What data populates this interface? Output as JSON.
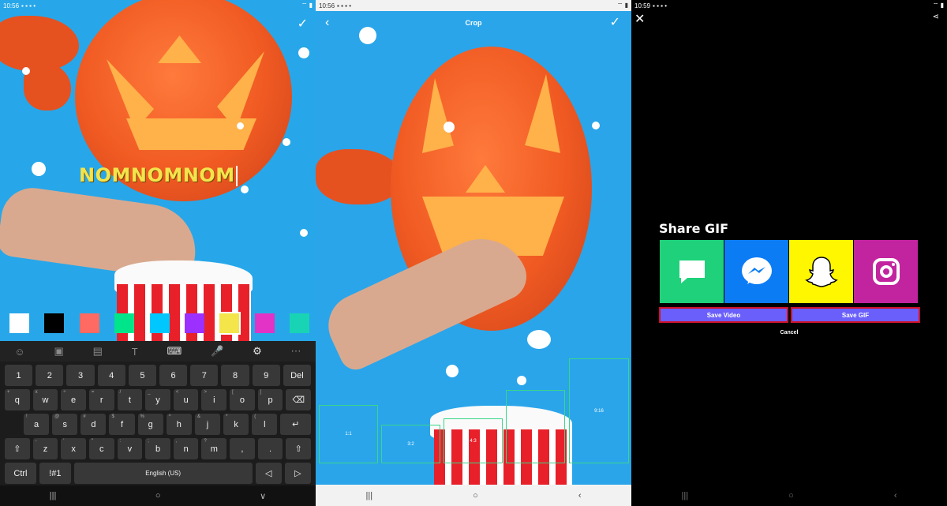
{
  "panel1": {
    "status_time": "10:56",
    "status_icons": "▪ ▪ ▪ •",
    "status_right": "⌔ ▮",
    "text_overlay": "NOMNOMNOM",
    "confirm_glyph": "✓",
    "swatches": [
      "#ffffff",
      "#000000",
      "#ff6a62",
      "#00e58a",
      "#00c8ff",
      "#9b30ff",
      "#f3e54a",
      "#e233c6",
      "#19d4b4"
    ],
    "selected_swatch": 6,
    "keyboard": {
      "toolbar": [
        "☺",
        "▣",
        "▤",
        "T",
        "⌨",
        "🎤",
        "⚙",
        "⋯"
      ],
      "row_numbers": [
        "1",
        "2",
        "3",
        "4",
        "5",
        "6",
        "7",
        "8",
        "9",
        "Del"
      ],
      "row_q": [
        [
          "q",
          "+"
        ],
        [
          "w",
          "x"
        ],
        [
          "e",
          "÷"
        ],
        [
          "r",
          "="
        ],
        [
          "t",
          "/"
        ],
        [
          "y",
          "_"
        ],
        [
          "u",
          "<"
        ],
        [
          "i",
          ">"
        ],
        [
          "o",
          "["
        ],
        [
          "p",
          "]"
        ],
        [
          "⌫",
          ""
        ]
      ],
      "row_a": [
        [
          "a",
          "!"
        ],
        [
          "s",
          "@"
        ],
        [
          "d",
          "#"
        ],
        [
          "f",
          "$"
        ],
        [
          "g",
          "%"
        ],
        [
          "h",
          "^"
        ],
        [
          "j",
          "&"
        ],
        [
          "k",
          "*"
        ],
        [
          "l",
          "("
        ],
        [
          "↵",
          ""
        ]
      ],
      "row_z": [
        [
          "⇧",
          ""
        ],
        [
          "z",
          "-"
        ],
        [
          "x",
          "'"
        ],
        [
          "c",
          "\""
        ],
        [
          "v",
          ":"
        ],
        [
          "b",
          ";"
        ],
        [
          "n",
          ","
        ],
        [
          "m",
          "?"
        ],
        [
          ",",
          ""
        ],
        [
          ".",
          ""
        ],
        [
          "⇧",
          ""
        ]
      ],
      "row_bottom": [
        "Ctrl",
        "!#1",
        "English (US)",
        "◁",
        "▷"
      ]
    },
    "nav": [
      "|||",
      "○",
      "∨"
    ]
  },
  "panel2": {
    "status_time": "10:56",
    "status_icons": "▪ ▪ ▪ •",
    "status_right": "⌔ ▮",
    "title": "Crop",
    "back_glyph": "‹",
    "confirm_glyph": "✓",
    "crop_ratios": [
      "1:1",
      "3:2",
      "4:3",
      "9:16"
    ],
    "nav": [
      "|||",
      "○",
      "‹"
    ]
  },
  "panel3": {
    "status_time": "10:59",
    "status_icons": "▪ ▪ ▪ •",
    "status_right": "⌔ ▮",
    "close_glyph": "✕",
    "share_glyph": "⋖",
    "title": "Share GIF",
    "tiles": [
      {
        "name": "messages",
        "color": "#1fd17a"
      },
      {
        "name": "messenger",
        "color": "#0c7cf4"
      },
      {
        "name": "snapchat",
        "color": "#fff700"
      },
      {
        "name": "instagram",
        "color": "#c2249f"
      }
    ],
    "save_video": "Save Video",
    "save_gif": "Save GIF",
    "cancel": "Cancel",
    "nav": [
      "|||",
      "○",
      "‹"
    ]
  }
}
